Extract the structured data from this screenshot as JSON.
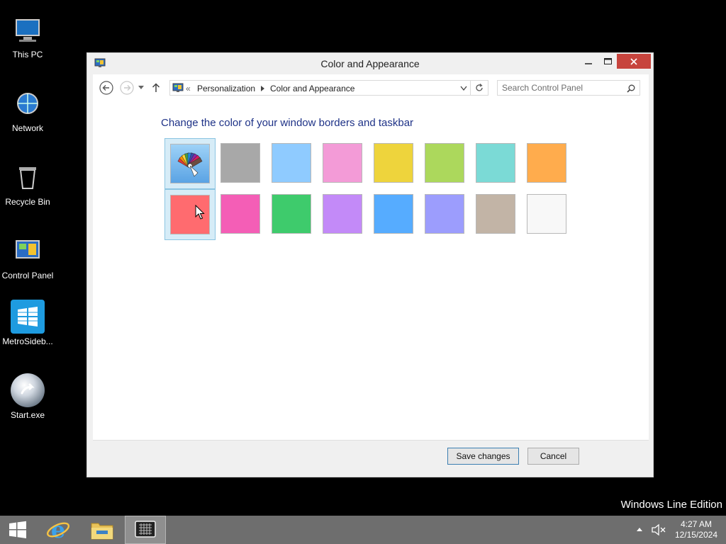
{
  "desktop": {
    "icons": [
      {
        "label": "This PC",
        "icon": "this-pc-icon"
      },
      {
        "label": "Network",
        "icon": "network-icon"
      },
      {
        "label": "Recycle Bin",
        "icon": "recycle-bin-icon"
      },
      {
        "label": "Control Panel",
        "icon": "control-panel-icon"
      },
      {
        "label": "MetroSideb...",
        "icon": "metro-sidebar-icon"
      },
      {
        "label": "Start.exe",
        "icon": "start-exe-icon"
      }
    ],
    "watermark": "Windows Line Edition"
  },
  "window": {
    "title": "Color and Appearance",
    "controls": {
      "minimize": "minimize-icon",
      "maximize": "maximize-icon",
      "close": "close-icon"
    },
    "address": {
      "separator": "«",
      "breadcrumb": [
        "Personalization",
        "Color and Appearance"
      ]
    },
    "search": {
      "placeholder": "Search Control Panel"
    },
    "heading": "Change the color of your window borders and taskbar",
    "swatches": [
      {
        "name": "automatic",
        "color": "#6aa8e0",
        "selected": false,
        "icon": "color-palette-icon"
      },
      {
        "name": "gray",
        "color": "#a8a8a8"
      },
      {
        "name": "light-blue",
        "color": "#8fcbff"
      },
      {
        "name": "pink",
        "color": "#f39bd7"
      },
      {
        "name": "yellow",
        "color": "#eed43c"
      },
      {
        "name": "lime",
        "color": "#acd85c"
      },
      {
        "name": "teal",
        "color": "#7bdad6"
      },
      {
        "name": "orange",
        "color": "#ffac4d"
      },
      {
        "name": "red",
        "color": "#ff6b6f",
        "selected": true
      },
      {
        "name": "magenta",
        "color": "#f45eb6"
      },
      {
        "name": "green",
        "color": "#3ecb6c"
      },
      {
        "name": "purple",
        "color": "#c38af8"
      },
      {
        "name": "blue",
        "color": "#56acff"
      },
      {
        "name": "periwinkle",
        "color": "#9c9dfd"
      },
      {
        "name": "taupe",
        "color": "#c2b4a6"
      },
      {
        "name": "white",
        "color": "#f8f8f8"
      }
    ],
    "buttons": {
      "save": "Save changes",
      "cancel": "Cancel"
    }
  },
  "taskbar": {
    "items": [
      "start-icon",
      "internet-explorer-icon",
      "file-explorer-icon",
      "control-panel-taskbar-icon"
    ],
    "tray": {
      "show_hidden": "tray-up-arrow-icon",
      "volume": "volume-muted-icon"
    },
    "clock": {
      "time": "4:27 AM",
      "date": "12/15/2024"
    }
  }
}
